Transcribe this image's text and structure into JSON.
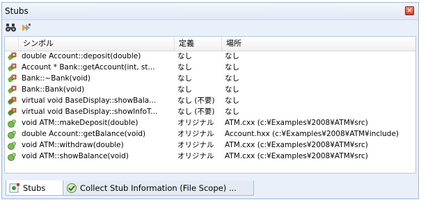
{
  "panel": {
    "title": "Stubs"
  },
  "toolbar": {
    "find_icon": "binoculars-icon",
    "stub_icon": "stub-tool-icon"
  },
  "columns": [
    "シンボル",
    "定義",
    "場所"
  ],
  "rows": [
    {
      "icon": "stub-red-icon",
      "symbol": "double Account::deposit(double)",
      "definition": "なし",
      "location": "なし"
    },
    {
      "icon": "stub-red-icon",
      "symbol": "Account * Bank::getAccount(int, st...",
      "definition": "なし",
      "location": "なし"
    },
    {
      "icon": "stub-red-icon",
      "symbol": "Bank::~Bank(void)",
      "definition": "なし",
      "location": "なし"
    },
    {
      "icon": "stub-red-icon",
      "symbol": "Bank::Bank(void)",
      "definition": "なし",
      "location": "なし"
    },
    {
      "icon": "stub-warn-icon",
      "symbol": "virtual void BaseDisplay::showBala...",
      "definition": "なし (不要)",
      "location": "なし"
    },
    {
      "icon": "stub-warn-icon",
      "symbol": "virtual void BaseDisplay::showInfoT...",
      "definition": "なし (不要)",
      "location": "なし"
    },
    {
      "icon": "stub-green-icon",
      "symbol": "void ATM::makeDeposit(double)",
      "definition": "オリジナル",
      "location": "ATM.cxx (c:¥Examples¥2008¥ATM¥src)"
    },
    {
      "icon": "stub-green-icon",
      "symbol": "double Account::getBalance(void)",
      "definition": "オリジナル",
      "location": "Account.hxx (c:¥Examples¥2008¥ATM¥include)"
    },
    {
      "icon": "stub-green-icon",
      "symbol": "void ATM::withdraw(double)",
      "definition": "オリジナル",
      "location": "ATM.cxx (c:¥Examples¥2008¥ATM¥src)"
    },
    {
      "icon": "stub-green-icon",
      "symbol": "void ATM::showBalance(void)",
      "definition": "オリジナル",
      "location": "ATM.cxx (c:¥Examples¥2008¥ATM¥src)"
    }
  ],
  "tabs": [
    {
      "label": "Stubs",
      "icon": "stubs-tab-icon",
      "active": true
    },
    {
      "label": "Collect Stub Information (File Scope) ...",
      "icon": "collect-tab-icon",
      "active": false
    }
  ],
  "colors": {
    "red": "#c8402c",
    "green": "#3c9a3c",
    "panel_border": "#9fb5d2",
    "panel_bg": "#eaf0f9"
  }
}
